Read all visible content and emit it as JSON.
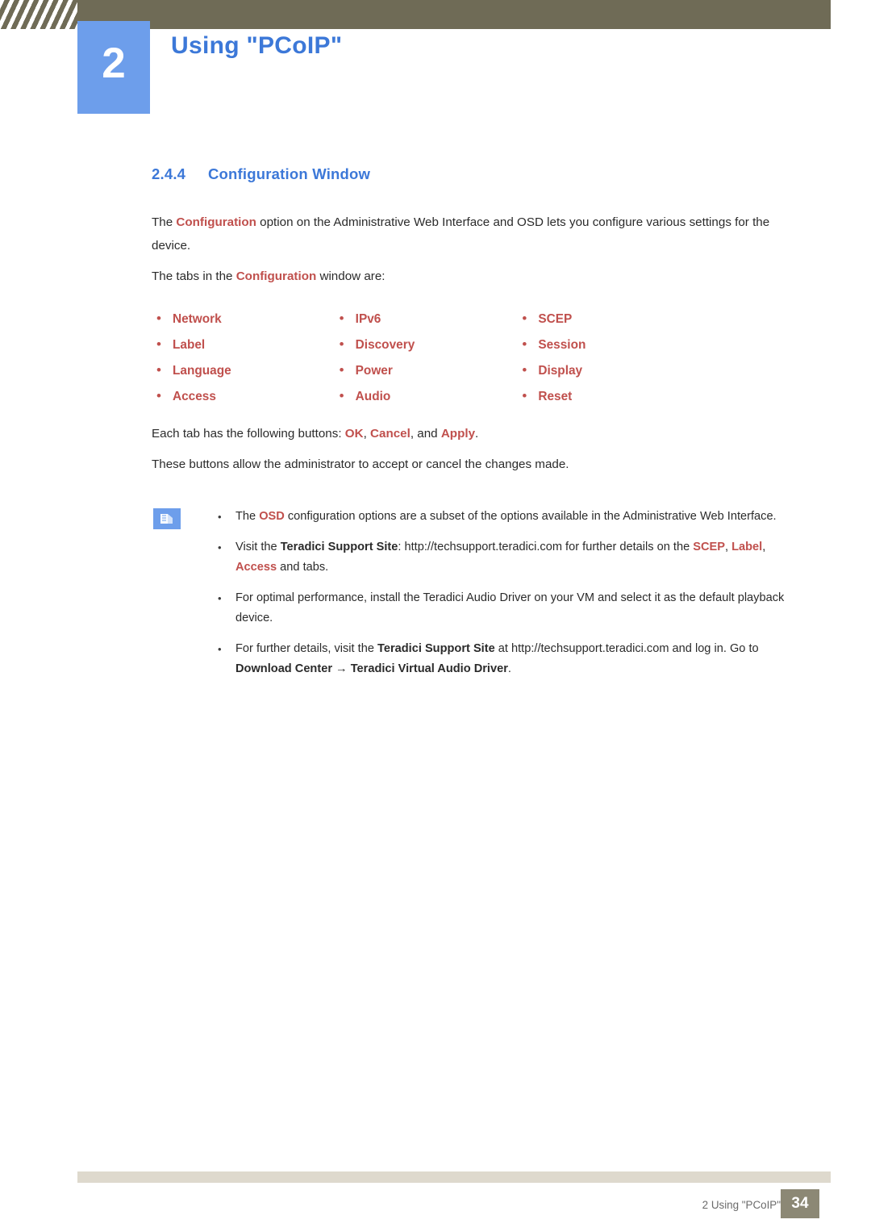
{
  "header": {
    "chapter_number": "2",
    "chapter_title": "Using \"PCoIP\""
  },
  "section": {
    "number": "2.4.4",
    "title": "Configuration Window"
  },
  "paragraphs": {
    "intro_1_a": "The ",
    "intro_1_b": "Configuration",
    "intro_1_c": " option on the Administrative Web Interface and OSD lets you configure various settings for the device.",
    "intro_2_a": "The tabs in the ",
    "intro_2_b": "Configuration",
    "intro_2_c": " window are:",
    "buttons_a": "Each tab has the following buttons: ",
    "buttons_ok": "OK",
    "buttons_sep1": ", ",
    "buttons_cancel": "Cancel",
    "buttons_sep2": ", and ",
    "buttons_apply": "Apply",
    "buttons_end": ".",
    "buttons_2": "These buttons allow the administrator to accept or cancel the changes made."
  },
  "tabs": [
    [
      "Network",
      "IPv6",
      "SCEP"
    ],
    [
      "Label",
      "Discovery",
      "Session"
    ],
    [
      "Language",
      "Power",
      "Display"
    ],
    [
      "Access",
      "Audio",
      "Reset"
    ]
  ],
  "notes": [
    {
      "parts": [
        {
          "t": "The ",
          "s": "normal"
        },
        {
          "t": "OSD",
          "s": "bold-orange"
        },
        {
          "t": " configuration options are a subset of the options available in the Administrative Web Interface.",
          "s": "normal"
        }
      ]
    },
    {
      "parts": [
        {
          "t": "Visit the ",
          "s": "normal"
        },
        {
          "t": "Teradici Support Site",
          "s": "bold-black"
        },
        {
          "t": ": http://techsupport.teradici.com for further details on the ",
          "s": "normal"
        },
        {
          "t": "SCEP",
          "s": "bold-orange"
        },
        {
          "t": ", ",
          "s": "normal"
        },
        {
          "t": "Label",
          "s": "bold-orange"
        },
        {
          "t": ",  ",
          "s": "normal"
        },
        {
          "t": "Access",
          "s": "bold-orange"
        },
        {
          "t": " and tabs.",
          "s": "normal"
        }
      ]
    },
    {
      "parts": [
        {
          "t": "For optimal performance, install the Teradici Audio Driver on your VM and select it as the default playback device.",
          "s": "normal"
        }
      ]
    },
    {
      "parts": [
        {
          "t": "For further details, visit the ",
          "s": "normal"
        },
        {
          "t": "Teradici Support Site",
          "s": "bold-black"
        },
        {
          "t": " at http://techsupport.teradici.com and log in. Go to ",
          "s": "normal"
        },
        {
          "t": "Download Center",
          "s": "bold-black"
        },
        {
          "t": "  →  ",
          "s": "normal"
        },
        {
          "t": "Teradici Virtual Audio Driver",
          "s": "bold-black"
        },
        {
          "t": ".",
          "s": "normal"
        }
      ]
    }
  ],
  "footer": {
    "text": "2 Using \"PCoIP\"",
    "page": "34"
  },
  "colors": {
    "accent_blue": "#3c78d8",
    "chapter_block": "#6d9eeb",
    "header_bar": "#6f6b56",
    "orange": "#c0504d",
    "footer_band": "#ded9cd",
    "footer_page": "#8c8875"
  }
}
